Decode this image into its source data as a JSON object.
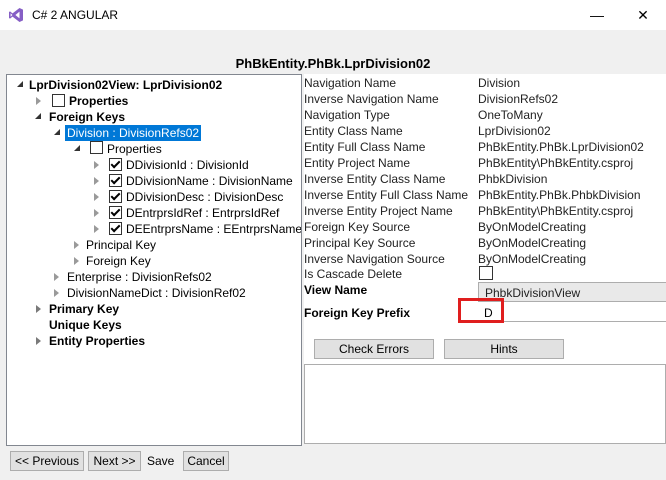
{
  "window": {
    "title": "C# 2 ANGULAR",
    "minimize_label": "—",
    "close_label": "✕"
  },
  "heading": "PhBkEntity.PhBk.LprDivision02",
  "tree": {
    "root": "LprDivision02View: LprDivision02",
    "properties": "Properties",
    "foreign_keys": "Foreign Keys",
    "division": "Division : DivisionRefs02",
    "division_properties": "Properties",
    "division_props": [
      "DDivisionId : DivisionId",
      "DDivisionName : DivisionName",
      "DDivisionDesc : DivisionDesc",
      "DEntrprsIdRef : EntrprsIdRef",
      "DEEntrprsName : EEntrprsName"
    ],
    "principal_key": "Principal Key",
    "foreign_key": "Foreign Key",
    "enterprise": "Enterprise : DivisionRefs02",
    "division_name_dict": "DivisionNameDict : DivisionRef02",
    "primary_key": "Primary Key",
    "unique_keys": "Unique Keys",
    "entity_properties": "Entity Properties"
  },
  "properties": [
    {
      "label": "Navigation Name",
      "value": "Division"
    },
    {
      "label": "Inverse Navigation Name",
      "value": "DivisionRefs02"
    },
    {
      "label": "Navigation Type",
      "value": "OneToMany"
    },
    {
      "label": "Entity Class Name",
      "value": "LprDivision02"
    },
    {
      "label": "Entity Full Class Name",
      "value": "PhBkEntity.PhBk.LprDivision02"
    },
    {
      "label": "Entity Project Name",
      "value": "PhBkEntity\\PhBkEntity.csproj"
    },
    {
      "label": "Inverse Entity Class Name",
      "value": "PhbkDivision"
    },
    {
      "label": "Inverse Entity Full Class Name",
      "value": "PhBkEntity.PhBk.PhbkDivision"
    },
    {
      "label": "Inverse Entity Project Name",
      "value": "PhBkEntity\\PhBkEntity.csproj"
    },
    {
      "label": "Foreign Key Source",
      "value": "ByOnModelCreating"
    },
    {
      "label": "Principal Key Source",
      "value": "ByOnModelCreating"
    },
    {
      "label": "Inverse Navigation Source",
      "value": "ByOnModelCreating"
    }
  ],
  "cascade_delete_label": "Is Cascade Delete",
  "view_name_label": "View Name",
  "view_name_value": "PhbkDivisionView",
  "fk_prefix_label": "Foreign Key Prefix",
  "fk_prefix_value": "D",
  "buttons": {
    "check_errors": "Check Errors",
    "hints": "Hints",
    "previous": "<< Previous",
    "next": "Next >>",
    "save": "Save",
    "cancel": "Cancel"
  }
}
